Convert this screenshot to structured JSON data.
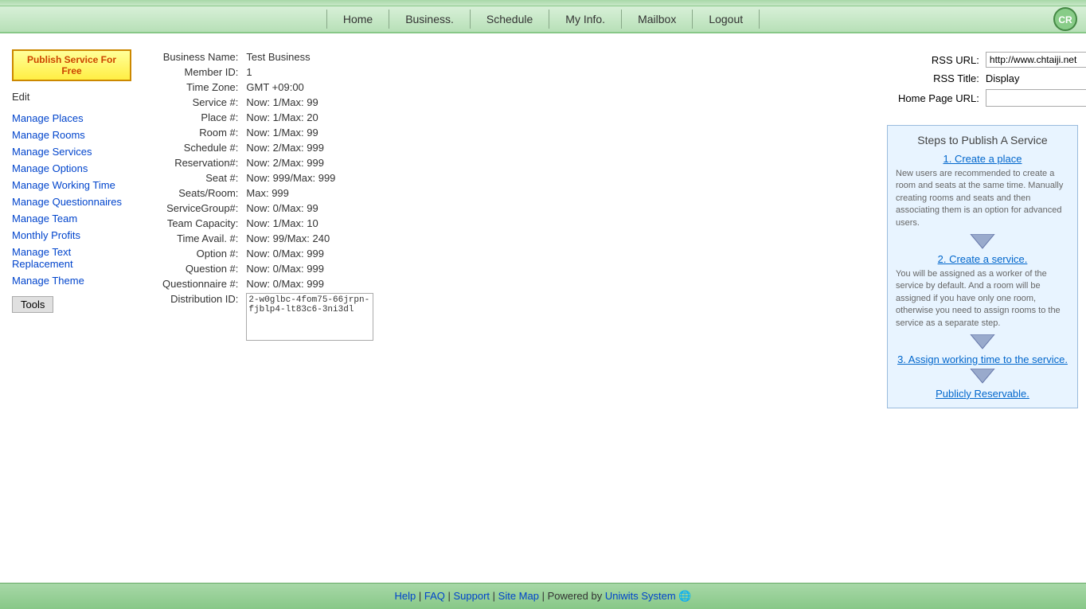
{
  "topbar": {},
  "nav": {
    "items": [
      {
        "label": "Home",
        "id": "home"
      },
      {
        "label": "Business.",
        "id": "business"
      },
      {
        "label": "Schedule",
        "id": "schedule"
      },
      {
        "label": "My Info.",
        "id": "myinfo"
      },
      {
        "label": "Mailbox",
        "id": "mailbox"
      },
      {
        "label": "Logout",
        "id": "logout"
      }
    ]
  },
  "sidebar": {
    "publish_btn": "Publish Service For Free",
    "edit_label": "Edit",
    "links": [
      {
        "label": "Manage Places",
        "id": "manage-places"
      },
      {
        "label": "Manage Rooms",
        "id": "manage-rooms"
      },
      {
        "label": "Manage Services",
        "id": "manage-services"
      },
      {
        "label": "Manage Options",
        "id": "manage-options"
      },
      {
        "label": "Manage Working Time",
        "id": "manage-working-time"
      },
      {
        "label": "Manage Questionnaires",
        "id": "manage-questionnaires"
      },
      {
        "label": "Manage Team",
        "id": "manage-team"
      },
      {
        "label": "Monthly Profits",
        "id": "monthly-profits"
      },
      {
        "label": "Manage Text Replacement",
        "id": "manage-text-replacement"
      },
      {
        "label": "Manage Theme",
        "id": "manage-theme"
      }
    ],
    "tools_label": "Tools"
  },
  "business": {
    "fields": [
      {
        "label": "Business Name:",
        "value": "Test Business"
      },
      {
        "label": "Member ID:",
        "value": "1"
      },
      {
        "label": "Time Zone:",
        "value": "GMT +09:00"
      },
      {
        "label": "Service #:",
        "value": "Now: 1/Max: 99"
      },
      {
        "label": "Place #:",
        "value": "Now: 1/Max: 20"
      },
      {
        "label": "Room #:",
        "value": "Now: 1/Max: 99"
      },
      {
        "label": "Schedule #:",
        "value": "Now: 2/Max: 999"
      },
      {
        "label": "Reservation#:",
        "value": "Now: 2/Max: 999"
      },
      {
        "label": "Seat #:",
        "value": "Now: 999/Max: 999"
      },
      {
        "label": "Seats/Room:",
        "value": "Max: 999"
      },
      {
        "label": "ServiceGroup#:",
        "value": "Now: 0/Max: 99"
      },
      {
        "label": "Team Capacity:",
        "value": "Now: 1/Max: 10"
      },
      {
        "label": "Time Avail. #:",
        "value": "Now: 99/Max: 240"
      },
      {
        "label": "Option #:",
        "value": "Now: 0/Max: 999"
      },
      {
        "label": "Question #:",
        "value": "Now: 0/Max: 999"
      },
      {
        "label": "Questionnaire #:",
        "value": "Now: 0/Max: 999"
      },
      {
        "label": "Distribution ID:",
        "value": "2-w0glbc-4fom75-66jrpn-fjblp4-lt83c6-3ni3dl"
      }
    ]
  },
  "rss": {
    "url_label": "RSS URL:",
    "url_value": "http://www.chtaiji.net",
    "title_label": "RSS Title:",
    "title_value": "Display",
    "home_page_label": "Home Page URL:",
    "home_page_value": ""
  },
  "steps": {
    "title": "Steps to Publish A Service",
    "step1_label": "1. Create a place",
    "step1_desc": "New users are recommended to create a room and seats at the same time. Manually creating rooms and seats and then associating them is an option for advanced users.",
    "step2_label": "2. Create a service.",
    "step2_desc": "You will be assigned as a worker of the service by default. And a room will be assigned if you have only one room, otherwise you need to assign rooms to the service as a separate step.",
    "step3_label": "3. Assign working time to the service.",
    "final_label": "Publicly Reservable."
  },
  "footer": {
    "help": "Help",
    "faq": "FAQ",
    "support": "Support",
    "sitemap": "Site Map",
    "powered_by": "| Powered by",
    "company": "Uniwits System"
  }
}
